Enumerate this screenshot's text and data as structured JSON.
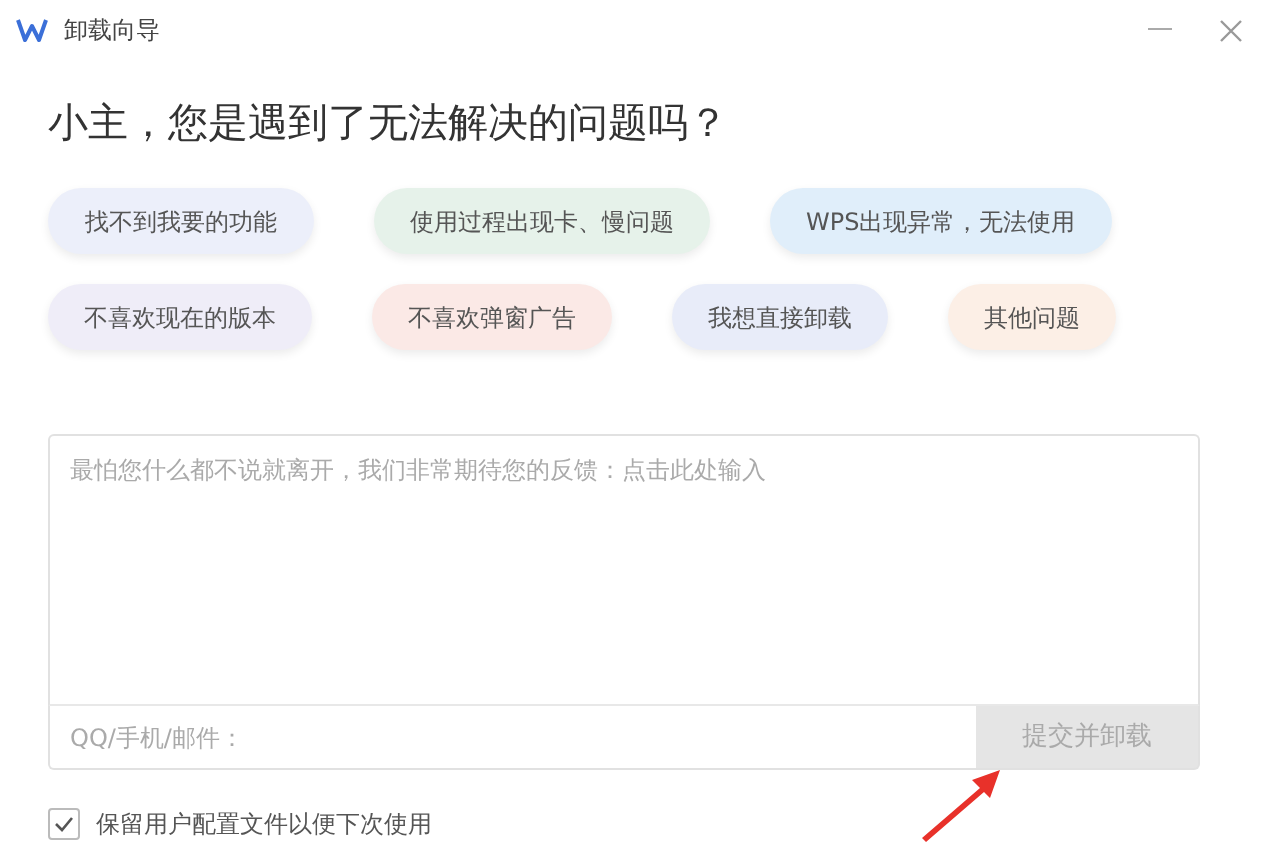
{
  "window": {
    "title": "卸载向导"
  },
  "heading": "小主，您是遇到了无法解决的问题吗？",
  "reasons": [
    {
      "label": "找不到我要的功能",
      "color": "#eceffa",
      "selected": false
    },
    {
      "label": "使用过程出现卡、慢问题",
      "color": "#e6f2ea",
      "selected": false
    },
    {
      "label": "WPS出现异常，无法使用",
      "color": "#e0eefa",
      "selected": false
    },
    {
      "label": "不喜欢现在的版本",
      "color": "#efedf8",
      "selected": false
    },
    {
      "label": "不喜欢弹窗广告",
      "color": "#fbe9e6",
      "selected": false
    },
    {
      "label": "我想直接卸载",
      "color": "#e8ecf9",
      "selected": false
    },
    {
      "label": "其他问题",
      "color": "#fcefe6",
      "selected": false
    }
  ],
  "feedback": {
    "placeholder": "最怕您什么都不说就离开，我们非常期待您的反馈：点击此处输入"
  },
  "contact": {
    "placeholder": "QQ/手机/邮件："
  },
  "submit": {
    "label": "提交并卸载",
    "disabled": true
  },
  "keep_config": {
    "label": "保留用户配置文件以便下次使用",
    "checked": true
  }
}
